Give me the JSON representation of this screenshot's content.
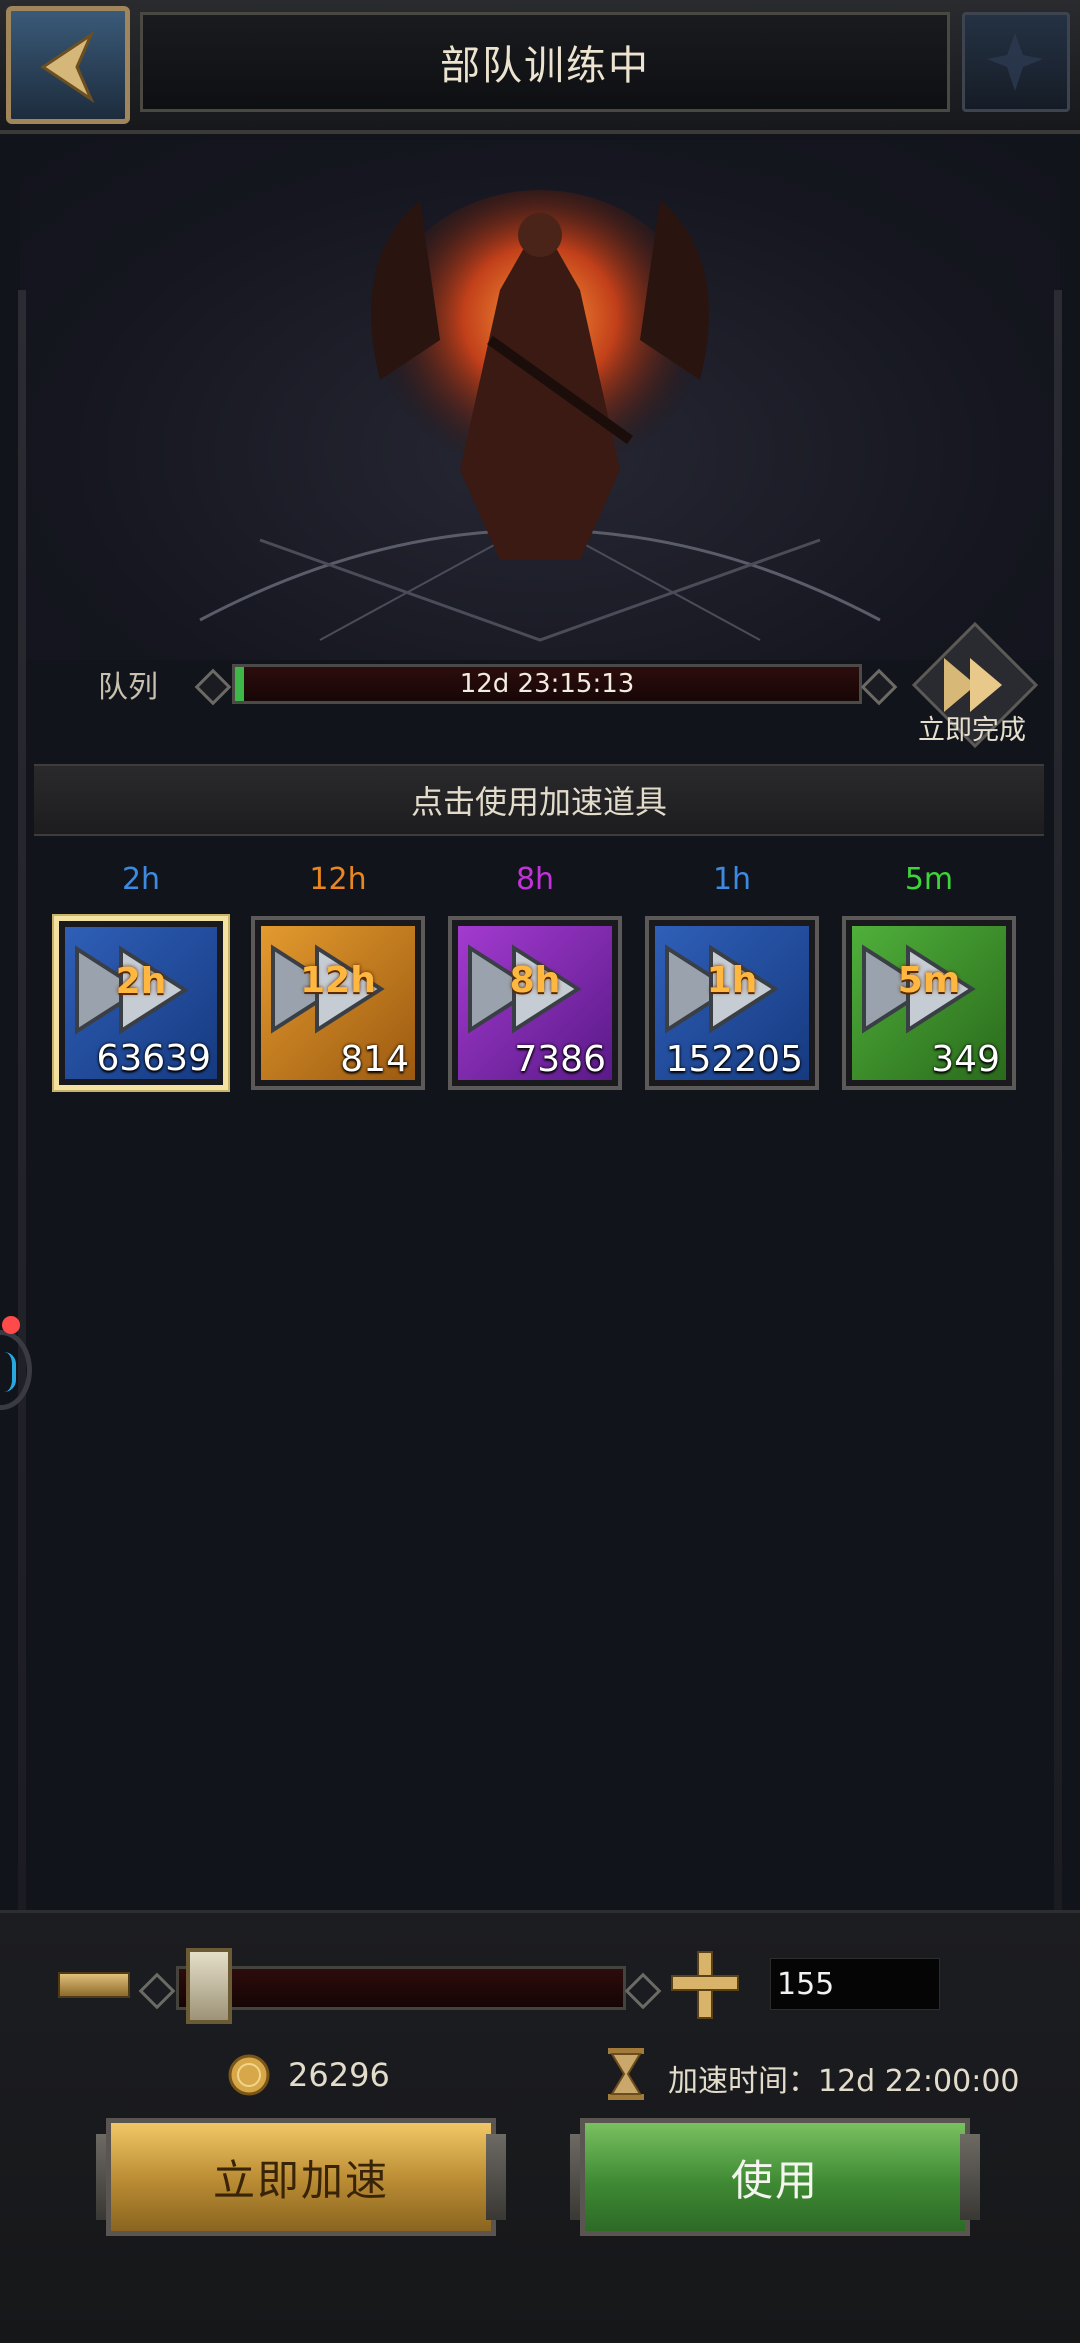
{
  "header": {
    "title": "部队训练中"
  },
  "queue": {
    "label": "队列",
    "timer": "12d 23:15:13",
    "progress_percent": 1.5
  },
  "instant": {
    "label": "立即完成"
  },
  "hint": "点击使用加速道具",
  "items": [
    {
      "label": "2h",
      "tag": "2h",
      "count": "63639",
      "label_color": "#3d8be0",
      "bg": "blue",
      "selected": true
    },
    {
      "label": "12h",
      "tag": "12h",
      "count": "814",
      "label_color": "#e8861f",
      "bg": "orange",
      "selected": false
    },
    {
      "label": "8h",
      "tag": "8h",
      "count": "7386",
      "label_color": "#c232d8",
      "bg": "purple",
      "selected": false
    },
    {
      "label": "1h",
      "tag": "1h",
      "count": "152205",
      "label_color": "#3d8be0",
      "bg": "blue",
      "selected": false
    },
    {
      "label": "5m",
      "tag": "5m",
      "count": "349",
      "label_color": "#3ed43a",
      "bg": "green",
      "selected": false
    }
  ],
  "bottom": {
    "quantity": "155",
    "slider_fraction": 0.05,
    "coins": "26296",
    "speed_time": "加速时间：12d 22:00:00",
    "instant_speed_button": "立即加速",
    "use_button": "使用"
  },
  "colors": {
    "gold": "#c9a14a",
    "green_button": "#4d9a3c",
    "selected_border": "#f3e2a0"
  }
}
